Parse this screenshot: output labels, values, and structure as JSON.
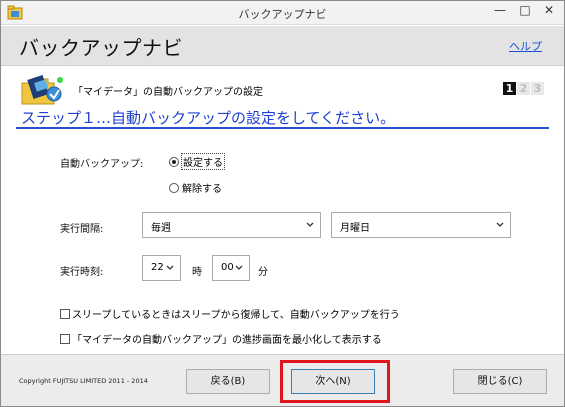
{
  "window": {
    "title": "バックアップナビ"
  },
  "header": {
    "app_title": "バックアップナビ",
    "help_link": "ヘルプ"
  },
  "section": {
    "title": "「マイデータ」の自動バックアップの設定"
  },
  "steps": {
    "items": [
      "1",
      "2",
      "3"
    ],
    "current": 1
  },
  "step_heading": "ステップ１…自動バックアップの設定をしてください。",
  "auto_backup": {
    "label": "自動バックアップ:",
    "options": [
      "設定する",
      "解除する"
    ],
    "selected": "設定する"
  },
  "interval": {
    "label": "実行間隔:",
    "frequency": "毎週",
    "day": "月曜日"
  },
  "run_time": {
    "label": "実行時刻:",
    "hour": "22",
    "hour_unit": "時",
    "minute": "00",
    "minute_unit": "分"
  },
  "checkboxes": [
    {
      "label": "スリープしているときはスリープから復帰して、自動バックアップを行う",
      "checked": false
    },
    {
      "label": "「マイデータの自動バックアップ」の進捗画面を最小化して表示する",
      "checked": false
    }
  ],
  "footer": {
    "copyright": "Copyright FUJITSU LIMITED 2011 - 2014",
    "back_label": "戻る(B)",
    "next_label": "次へ(N)",
    "close_label": "閉じる(C)"
  },
  "colors": {
    "accent": "#1f3fd0",
    "highlight": "#e0161e",
    "link": "#1a53d1"
  },
  "icons": [
    "app-icon",
    "backup-folder-icon",
    "minimize-icon",
    "maximize-icon",
    "close-icon",
    "chevron-down-icon"
  ]
}
